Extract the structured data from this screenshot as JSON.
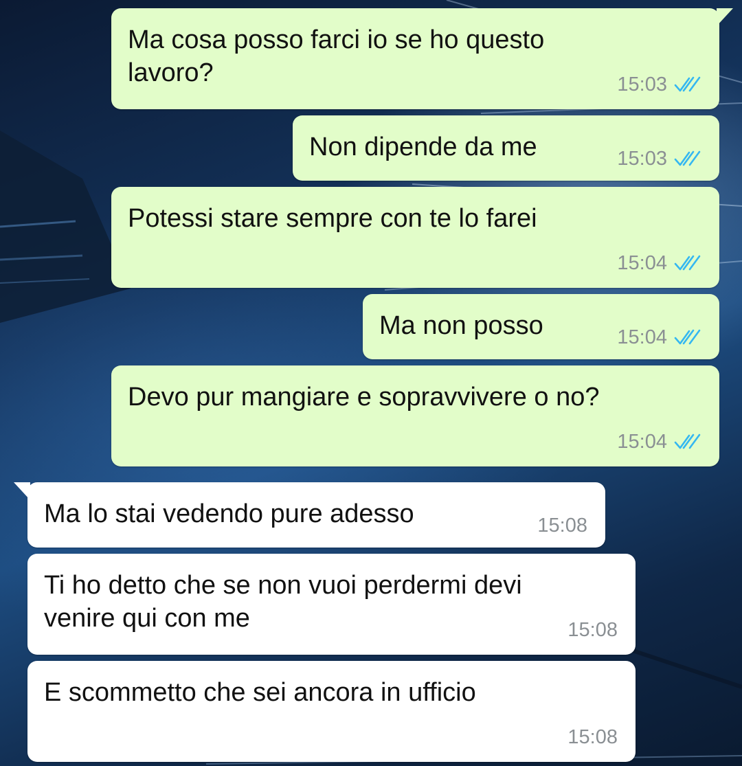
{
  "colors": {
    "outgoing_bubble": "#e2fdc9",
    "incoming_bubble": "#ffffff",
    "timestamp": "#8a8f93",
    "read_ticks": "#34b7f1"
  },
  "messages": [
    {
      "direction": "outgoing",
      "lines": [
        "Ma cosa posso farci io se ho questo",
        "lavoro?"
      ],
      "time": "15:03",
      "status": "read-double-tick-icon"
    },
    {
      "direction": "outgoing",
      "lines": [
        "Non dipende da me"
      ],
      "time": "15:03",
      "status": "read-double-tick-icon"
    },
    {
      "direction": "outgoing",
      "lines": [
        "Potessi stare sempre con te lo farei"
      ],
      "time": "15:04",
      "status": "read-double-tick-icon"
    },
    {
      "direction": "outgoing",
      "lines": [
        "Ma non posso"
      ],
      "time": "15:04",
      "status": "read-double-tick-icon"
    },
    {
      "direction": "outgoing",
      "lines": [
        "Devo pur mangiare e sopravvivere o no?"
      ],
      "time": "15:04",
      "status": "read-double-tick-icon"
    },
    {
      "direction": "incoming",
      "lines": [
        "Ma lo stai vedendo pure adesso"
      ],
      "time": "15:08"
    },
    {
      "direction": "incoming",
      "lines": [
        "Ti ho detto che se non vuoi perdermi devi",
        "venire qui con me"
      ],
      "time": "15:08"
    },
    {
      "direction": "incoming",
      "lines": [
        "E scommetto che sei ancora in ufficio"
      ],
      "time": "15:08"
    }
  ]
}
